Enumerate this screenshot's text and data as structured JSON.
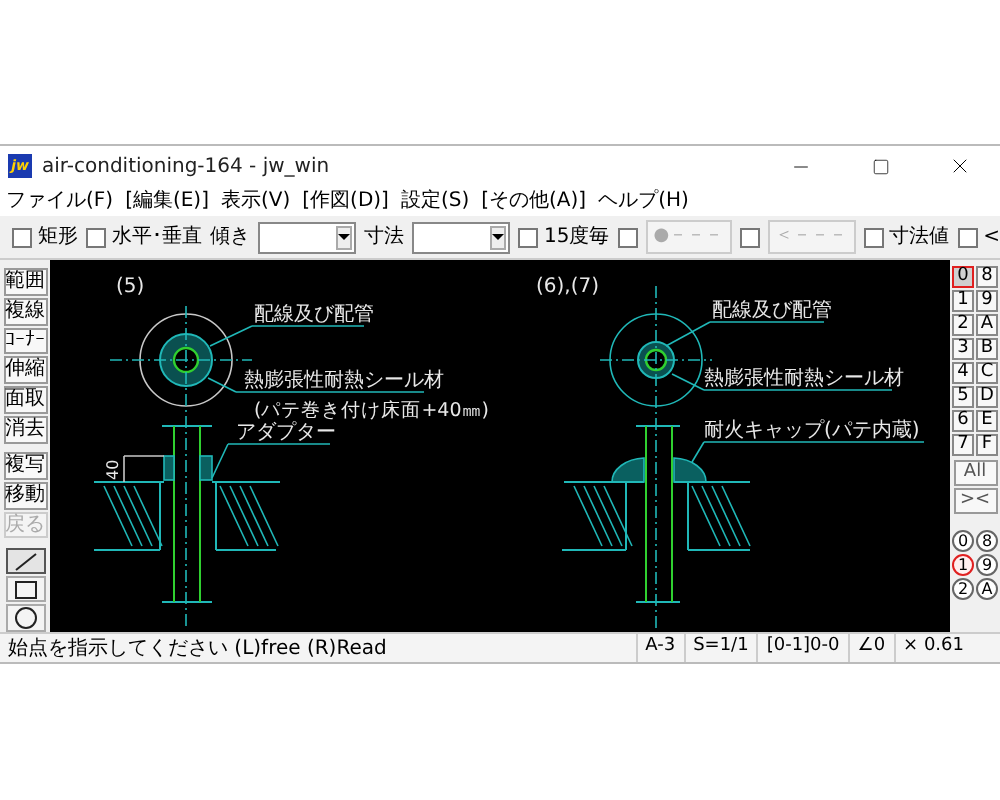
{
  "window": {
    "title": "air-conditioning-164 - jw_win",
    "logo": "jw"
  },
  "menu": [
    {
      "label": "ファイル(F)"
    },
    {
      "label": "[編集(E)]"
    },
    {
      "label": "表示(V)"
    },
    {
      "label": "[作図(D)]"
    },
    {
      "label": "設定(S)"
    },
    {
      "label": "[その他(A)]"
    },
    {
      "label": "ヘルプ(H)"
    }
  ],
  "toolbar": [
    {
      "kind": "checkbox",
      "label": "矩形",
      "checked": false
    },
    {
      "kind": "checkbox",
      "label": "水平･垂直",
      "checked": false
    },
    {
      "kind": "label",
      "label": "傾き"
    },
    {
      "kind": "dropdown"
    },
    {
      "kind": "label",
      "label": "寸法"
    },
    {
      "kind": "dropdown"
    },
    {
      "kind": "checkbox",
      "label": "15度毎",
      "checked": false
    },
    {
      "kind": "checkbox",
      "checked": false
    },
    {
      "kind": "button",
      "label": "●－－－",
      "disabled": true
    },
    {
      "kind": "checkbox",
      "checked": false
    },
    {
      "kind": "button",
      "label": "＜－－－",
      "disabled": true
    },
    {
      "kind": "checkbox",
      "label": "寸法値",
      "checked": false
    },
    {
      "kind": "checkbox",
      "label": "<",
      "checked": false
    }
  ],
  "tools": [
    {
      "label": "範囲",
      "disabled": false
    },
    {
      "label": "複線",
      "disabled": false
    },
    {
      "label": "ｺｰﾅｰ",
      "disabled": false
    },
    {
      "label": "伸縮",
      "disabled": false
    },
    {
      "label": "面取",
      "disabled": false
    },
    {
      "label": "消去",
      "disabled": false
    },
    {
      "label": "複写",
      "disabled": false
    },
    {
      "label": "移動",
      "disabled": false
    },
    {
      "label": "戻る",
      "disabled": true
    }
  ],
  "draw_tools": [
    {
      "kind": "line",
      "selected": true
    },
    {
      "kind": "rectangle",
      "selected": false
    },
    {
      "kind": "circle",
      "selected": false
    }
  ],
  "drawing": {
    "sections": [
      {
        "number": "(5)",
        "labels": [
          "配線及び配管",
          "熱膨張性耐熱シール材",
          "(パテ巻き付け床面+40㎜)",
          "アダプター"
        ],
        "dimension": "40"
      },
      {
        "number": "(6),(7)",
        "labels": [
          "配線及び配管",
          "熱膨張性耐熱シール材",
          "耐火キャップ(パテ内蔵)"
        ]
      }
    ]
  },
  "layers": [
    {
      "label": "0",
      "selected": true
    },
    {
      "label": "8",
      "selected": false
    },
    {
      "label": "1",
      "selected": false
    },
    {
      "label": "9",
      "selected": false
    },
    {
      "label": "2",
      "selected": false
    },
    {
      "label": "A",
      "selected": false
    },
    {
      "label": "3",
      "selected": false
    },
    {
      "label": "B",
      "selected": false
    },
    {
      "label": "4",
      "selected": false
    },
    {
      "label": "C",
      "selected": false
    },
    {
      "label": "5",
      "selected": false
    },
    {
      "label": "D",
      "selected": false
    },
    {
      "label": "6",
      "selected": false
    },
    {
      "label": "E",
      "selected": false
    },
    {
      "label": "7",
      "selected": false
    },
    {
      "label": "F",
      "selected": false
    }
  ],
  "layer_buttons": [
    "All",
    "><"
  ],
  "layer_groups": [
    {
      "label": "0",
      "selected": false
    },
    {
      "label": "8",
      "selected": false
    },
    {
      "label": "1",
      "selected": true
    },
    {
      "label": "9",
      "selected": false
    },
    {
      "label": "2",
      "selected": false
    },
    {
      "label": "A",
      "selected": false
    }
  ],
  "status_bar": {
    "message": "始点を指示してください (L)free (R)Read",
    "fields": [
      "A-3",
      "S=1/1",
      "[0-1]0-0",
      "∠0",
      "× 0.61"
    ]
  }
}
